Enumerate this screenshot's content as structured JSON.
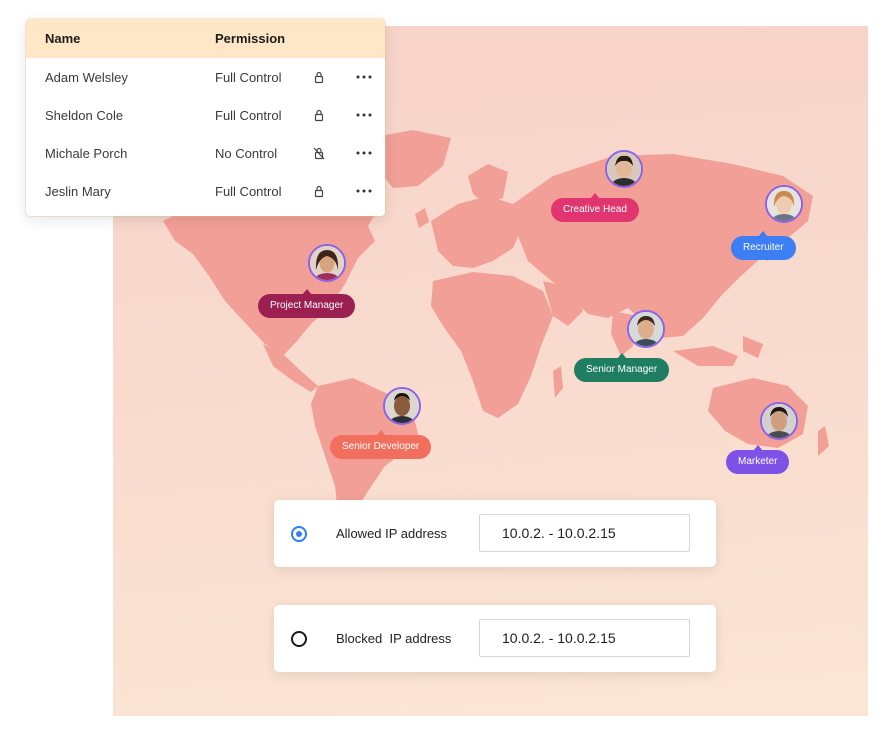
{
  "permissions": {
    "headers": {
      "name": "Name",
      "permission": "Permission"
    },
    "rows": [
      {
        "name": "Adam Welsley",
        "permission": "Full Control",
        "icon": "lock-icon"
      },
      {
        "name": "Sheldon Cole",
        "permission": "Full Control",
        "icon": "lock-icon"
      },
      {
        "name": "Michale Porch",
        "permission": "No Control",
        "icon": "unlock-icon"
      },
      {
        "name": "Jeslin Mary",
        "permission": "Full Control",
        "icon": "lock-icon"
      }
    ]
  },
  "people": [
    {
      "role": "Creative Head",
      "color": "#e0356e"
    },
    {
      "role": "Recruiter",
      "color": "#3d7ef5"
    },
    {
      "role": "Project Manager",
      "color": "#9c1f52"
    },
    {
      "role": "Senior Manager",
      "color": "#1f7d62"
    },
    {
      "role": "Senior Developer",
      "color": "#f26e5d"
    },
    {
      "role": "Marketer",
      "color": "#7e52e6"
    }
  ],
  "ip_rules": {
    "allowed": {
      "label": "Allowed IP address",
      "value": "10.0.2. - 10.0.2.15",
      "selected": true
    },
    "blocked": {
      "label": "Blocked  IP address",
      "value": "10.0.2. - 10.0.2.15",
      "selected": false
    }
  },
  "colors": {
    "map_land": "#f2a097",
    "header_bg": "#fde7c7",
    "radio_selected": "#2d7ff9",
    "avatar_ring": "#8a63e6"
  }
}
